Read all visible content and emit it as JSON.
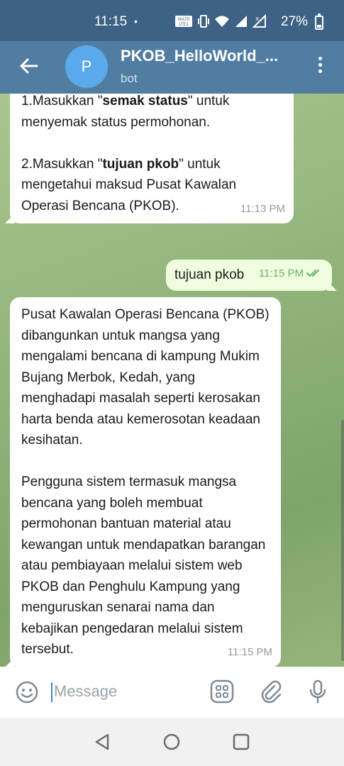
{
  "status_bar": {
    "time": "11:15",
    "dot": "•",
    "battery_percent": "27%",
    "battery_level": 0.27,
    "icons": [
      "volte-icon",
      "vibrate-icon",
      "wifi-icon",
      "signal-icon",
      "signal-x-icon",
      "battery-icon"
    ]
  },
  "header": {
    "avatar_letter": "P",
    "title": "PKOB_HelloWorld_...",
    "subtitle": "bot",
    "colors": {
      "header": "#517da2",
      "status": "#3d6285",
      "avatar": "#5aa9ec"
    }
  },
  "messages": [
    {
      "direction": "incoming",
      "paragraphs": [
        {
          "parts": [
            {
              "text": "1.Masukkan \""
            },
            {
              "text": "semak status",
              "bold": true
            },
            {
              "text": "\" untuk menyemak status permohonan."
            }
          ]
        },
        {
          "parts": [
            {
              "text": "2.Masukkan \""
            },
            {
              "text": "tujuan pkob",
              "bold": true
            },
            {
              "text": "\" untuk mengetahui maksud Pusat Kawalan Operasi Bencana (PKOB)."
            }
          ]
        }
      ],
      "time": "11:13 PM"
    },
    {
      "direction": "outgoing",
      "text": "tujuan pkob",
      "time": "11:15 PM",
      "status": "read"
    },
    {
      "direction": "incoming",
      "paragraphs": [
        "Pusat Kawalan Operasi Bencana (PKOB) dibangunkan untuk mangsa yang mengalami bencana di kampung Mukim Bujang Merbok, Kedah, yang menghadapi masalah seperti kerosakan harta benda atau kemerosotan keadaan kesihatan.",
        "Pengguna sistem termasuk mangsa bencana yang boleh membuat permohonan bantuan material atau kewangan untuk mendapatkan barangan atau pembiayaan melalui sistem web PKOB dan Penghulu Kampung yang menguruskan senarai nama dan kebajikan pengedaran melalui sistem tersebut."
      ],
      "time": "11:15 PM"
    }
  ],
  "input": {
    "placeholder": "Message"
  },
  "colors": {
    "incoming_bubble": "#ffffff",
    "outgoing_bubble": "#effdde",
    "read_ticks": "#6bb06b",
    "accent": "#3e88cf"
  }
}
